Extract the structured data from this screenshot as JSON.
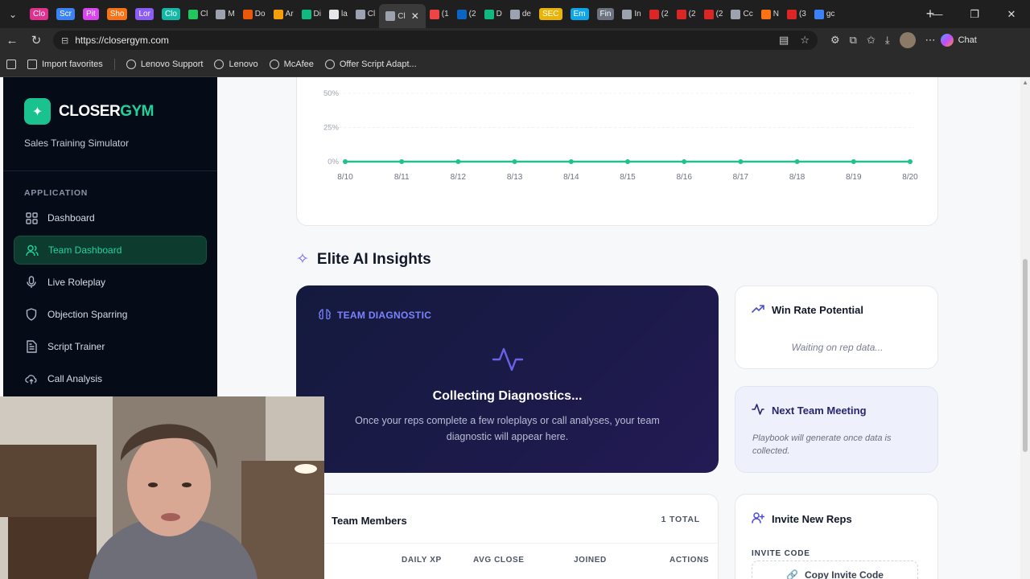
{
  "browser": {
    "tabs": [
      {
        "label": "Clo",
        "color": "#e0318e",
        "chip": true
      },
      {
        "label": "Scr",
        "color": "#3b82f6",
        "chip": true
      },
      {
        "label": "Pit",
        "color": "#d946ef",
        "chip": true
      },
      {
        "label": "Sho",
        "color": "#f97316",
        "chip": true
      },
      {
        "label": "Lor",
        "color": "#8b5cf6",
        "chip": true
      },
      {
        "label": "Clo",
        "color": "#14b8a6",
        "chip": true
      },
      {
        "label": "Cl",
        "color": "#22c55e",
        "chip": false
      },
      {
        "label": "M",
        "color": "#9ca3af",
        "chip": false
      },
      {
        "label": "Do",
        "color": "#ea580c",
        "chip": false
      },
      {
        "label": "Ar",
        "color": "#f59e0b",
        "chip": false
      },
      {
        "label": "Di",
        "color": "#10b981",
        "chip": false
      },
      {
        "label": "la",
        "color": "#e5e7eb",
        "chip": false
      },
      {
        "label": "Cl",
        "color": "#9ca3af",
        "chip": false
      }
    ],
    "active_tab": {
      "label": "Cl",
      "close": "✕"
    },
    "tabs_after": [
      {
        "label": "(1",
        "color": "#ef4444",
        "chip": false
      },
      {
        "label": "(2",
        "color": "#0a66c2",
        "chip": false
      },
      {
        "label": "D",
        "color": "#10b981",
        "chip": false
      },
      {
        "label": "de",
        "color": "#9ca3af",
        "chip": false
      },
      {
        "label": "SEC",
        "color": "#eab308",
        "chip": true
      },
      {
        "label": "Em",
        "color": "#0ea5e9",
        "chip": true
      },
      {
        "label": "Fin",
        "color": "#6b7280",
        "chip": true
      },
      {
        "label": "In",
        "color": "#9ca3af",
        "chip": false
      },
      {
        "label": "(2",
        "color": "#dc2626",
        "chip": false
      },
      {
        "label": "(2",
        "color": "#dc2626",
        "chip": false
      },
      {
        "label": "(2",
        "color": "#dc2626",
        "chip": false
      },
      {
        "label": "Cc",
        "color": "#9ca3af",
        "chip": false
      },
      {
        "label": "N",
        "color": "#f97316",
        "chip": false
      },
      {
        "label": "(3",
        "color": "#dc2626",
        "chip": false
      },
      {
        "label": "gc",
        "color": "#3b82f6",
        "chip": false
      }
    ],
    "new_tab": "+",
    "url": "https://closergym.com",
    "chat_label": "Chat",
    "bookmarks": [
      "Import favorites",
      "Lenovo Support",
      "Lenovo",
      "McAfee",
      "Offer Script Adapt..."
    ]
  },
  "sidebar": {
    "brand_prefix": "CLOSER",
    "brand_suffix": "GYM",
    "tagline": "Sales Training Simulator",
    "section": "APPLICATION",
    "items": [
      {
        "label": "Dashboard",
        "icon": "grid-icon",
        "active": false
      },
      {
        "label": "Team Dashboard",
        "icon": "users-icon",
        "active": true
      },
      {
        "label": "Live Roleplay",
        "icon": "mic-icon",
        "active": false
      },
      {
        "label": "Objection Sparring",
        "icon": "shield-icon",
        "active": false
      },
      {
        "label": "Script Trainer",
        "icon": "document-icon",
        "active": false
      },
      {
        "label": "Call Analysis",
        "icon": "cloud-upload-icon",
        "active": false
      }
    ]
  },
  "chart_data": {
    "type": "line",
    "categories": [
      "8/10",
      "8/11",
      "8/12",
      "8/13",
      "8/14",
      "8/15",
      "8/16",
      "8/17",
      "8/18",
      "8/19",
      "8/20"
    ],
    "series": [
      {
        "values": [
          0,
          0,
          0,
          0,
          0,
          0,
          0,
          0,
          0,
          0,
          0
        ],
        "color": "#22c08a"
      }
    ],
    "y_ticks": [
      "0%",
      "25%",
      "50%"
    ],
    "y_tick_values": [
      0,
      25,
      50
    ],
    "grid": true
  },
  "insights": {
    "title": "Elite AI Insights",
    "diagnostic": {
      "label": "TEAM DIAGNOSTIC",
      "heading": "Collecting Diagnostics...",
      "body": "Once your reps complete a few roleplays or call analyses, your team diagnostic will appear here."
    },
    "win_rate": {
      "title": "Win Rate Potential",
      "status": "Waiting on rep data..."
    },
    "meeting": {
      "title": "Next Team Meeting",
      "body": "Playbook will generate once data is collected."
    }
  },
  "members": {
    "title": "Team Members",
    "total": "1 TOTAL",
    "columns": [
      "DAILY XP",
      "AVG CLOSE",
      "JOINED",
      "ACTIONS"
    ]
  },
  "invite": {
    "title": "Invite New Reps",
    "code_label": "INVITE CODE",
    "copy_label": "Copy Invite Code"
  }
}
